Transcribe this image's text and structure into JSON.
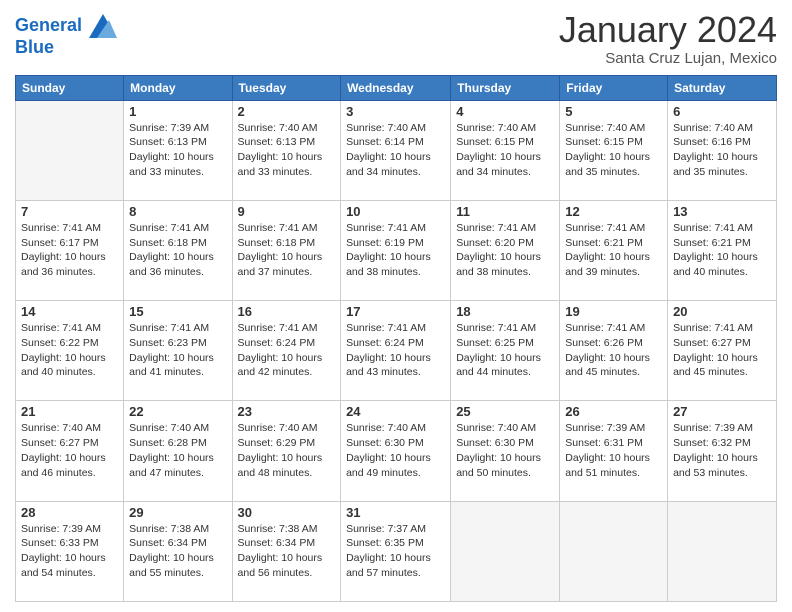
{
  "logo": {
    "line1": "General",
    "line2": "Blue"
  },
  "header": {
    "month": "January 2024",
    "location": "Santa Cruz Lujan, Mexico"
  },
  "days_of_week": [
    "Sunday",
    "Monday",
    "Tuesday",
    "Wednesday",
    "Thursday",
    "Friday",
    "Saturday"
  ],
  "weeks": [
    [
      {
        "day": "",
        "info": ""
      },
      {
        "day": "1",
        "info": "Sunrise: 7:39 AM\nSunset: 6:13 PM\nDaylight: 10 hours\nand 33 minutes."
      },
      {
        "day": "2",
        "info": "Sunrise: 7:40 AM\nSunset: 6:13 PM\nDaylight: 10 hours\nand 33 minutes."
      },
      {
        "day": "3",
        "info": "Sunrise: 7:40 AM\nSunset: 6:14 PM\nDaylight: 10 hours\nand 34 minutes."
      },
      {
        "day": "4",
        "info": "Sunrise: 7:40 AM\nSunset: 6:15 PM\nDaylight: 10 hours\nand 34 minutes."
      },
      {
        "day": "5",
        "info": "Sunrise: 7:40 AM\nSunset: 6:15 PM\nDaylight: 10 hours\nand 35 minutes."
      },
      {
        "day": "6",
        "info": "Sunrise: 7:40 AM\nSunset: 6:16 PM\nDaylight: 10 hours\nand 35 minutes."
      }
    ],
    [
      {
        "day": "7",
        "info": "Sunrise: 7:41 AM\nSunset: 6:17 PM\nDaylight: 10 hours\nand 36 minutes."
      },
      {
        "day": "8",
        "info": "Sunrise: 7:41 AM\nSunset: 6:18 PM\nDaylight: 10 hours\nand 36 minutes."
      },
      {
        "day": "9",
        "info": "Sunrise: 7:41 AM\nSunset: 6:18 PM\nDaylight: 10 hours\nand 37 minutes."
      },
      {
        "day": "10",
        "info": "Sunrise: 7:41 AM\nSunset: 6:19 PM\nDaylight: 10 hours\nand 38 minutes."
      },
      {
        "day": "11",
        "info": "Sunrise: 7:41 AM\nSunset: 6:20 PM\nDaylight: 10 hours\nand 38 minutes."
      },
      {
        "day": "12",
        "info": "Sunrise: 7:41 AM\nSunset: 6:21 PM\nDaylight: 10 hours\nand 39 minutes."
      },
      {
        "day": "13",
        "info": "Sunrise: 7:41 AM\nSunset: 6:21 PM\nDaylight: 10 hours\nand 40 minutes."
      }
    ],
    [
      {
        "day": "14",
        "info": "Sunrise: 7:41 AM\nSunset: 6:22 PM\nDaylight: 10 hours\nand 40 minutes."
      },
      {
        "day": "15",
        "info": "Sunrise: 7:41 AM\nSunset: 6:23 PM\nDaylight: 10 hours\nand 41 minutes."
      },
      {
        "day": "16",
        "info": "Sunrise: 7:41 AM\nSunset: 6:24 PM\nDaylight: 10 hours\nand 42 minutes."
      },
      {
        "day": "17",
        "info": "Sunrise: 7:41 AM\nSunset: 6:24 PM\nDaylight: 10 hours\nand 43 minutes."
      },
      {
        "day": "18",
        "info": "Sunrise: 7:41 AM\nSunset: 6:25 PM\nDaylight: 10 hours\nand 44 minutes."
      },
      {
        "day": "19",
        "info": "Sunrise: 7:41 AM\nSunset: 6:26 PM\nDaylight: 10 hours\nand 45 minutes."
      },
      {
        "day": "20",
        "info": "Sunrise: 7:41 AM\nSunset: 6:27 PM\nDaylight: 10 hours\nand 45 minutes."
      }
    ],
    [
      {
        "day": "21",
        "info": "Sunrise: 7:40 AM\nSunset: 6:27 PM\nDaylight: 10 hours\nand 46 minutes."
      },
      {
        "day": "22",
        "info": "Sunrise: 7:40 AM\nSunset: 6:28 PM\nDaylight: 10 hours\nand 47 minutes."
      },
      {
        "day": "23",
        "info": "Sunrise: 7:40 AM\nSunset: 6:29 PM\nDaylight: 10 hours\nand 48 minutes."
      },
      {
        "day": "24",
        "info": "Sunrise: 7:40 AM\nSunset: 6:30 PM\nDaylight: 10 hours\nand 49 minutes."
      },
      {
        "day": "25",
        "info": "Sunrise: 7:40 AM\nSunset: 6:30 PM\nDaylight: 10 hours\nand 50 minutes."
      },
      {
        "day": "26",
        "info": "Sunrise: 7:39 AM\nSunset: 6:31 PM\nDaylight: 10 hours\nand 51 minutes."
      },
      {
        "day": "27",
        "info": "Sunrise: 7:39 AM\nSunset: 6:32 PM\nDaylight: 10 hours\nand 53 minutes."
      }
    ],
    [
      {
        "day": "28",
        "info": "Sunrise: 7:39 AM\nSunset: 6:33 PM\nDaylight: 10 hours\nand 54 minutes."
      },
      {
        "day": "29",
        "info": "Sunrise: 7:38 AM\nSunset: 6:34 PM\nDaylight: 10 hours\nand 55 minutes."
      },
      {
        "day": "30",
        "info": "Sunrise: 7:38 AM\nSunset: 6:34 PM\nDaylight: 10 hours\nand 56 minutes."
      },
      {
        "day": "31",
        "info": "Sunrise: 7:37 AM\nSunset: 6:35 PM\nDaylight: 10 hours\nand 57 minutes."
      },
      {
        "day": "",
        "info": ""
      },
      {
        "day": "",
        "info": ""
      },
      {
        "day": "",
        "info": ""
      }
    ]
  ]
}
